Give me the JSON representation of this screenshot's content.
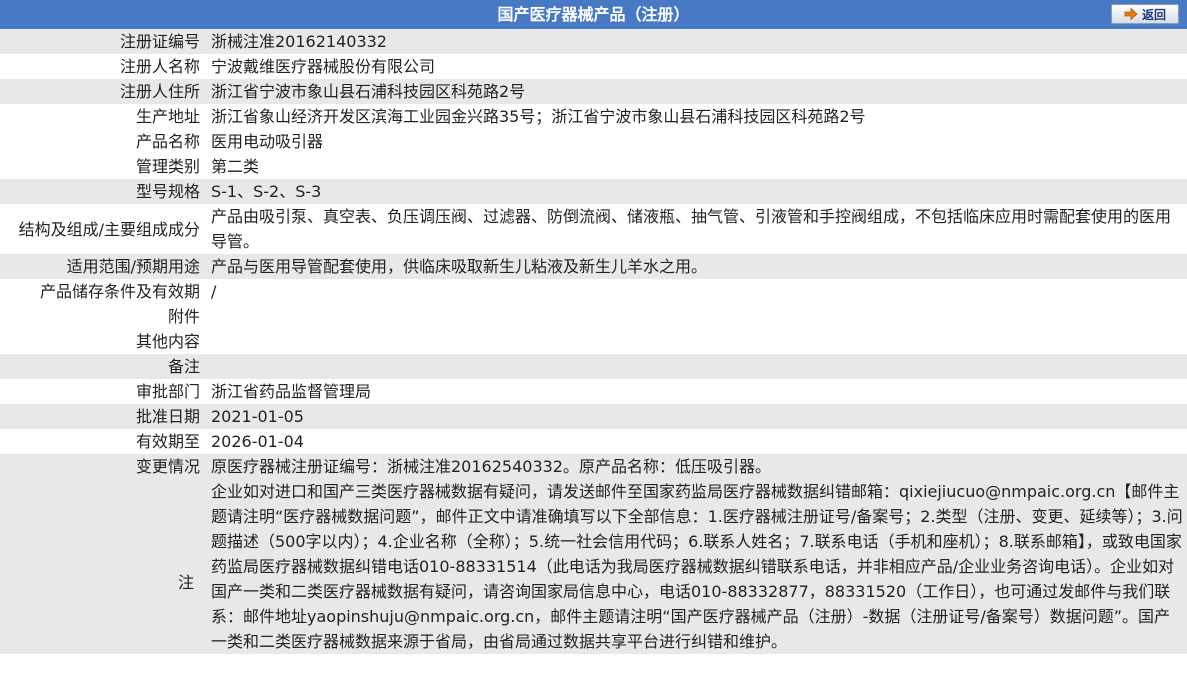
{
  "header": {
    "title": "国产医疗器械产品（注册）",
    "back_label": "返回"
  },
  "rows": {
    "reg_no": {
      "label": "注册证编号",
      "value": "浙械注准20162140332"
    },
    "registrant": {
      "label": "注册人名称",
      "value": "宁波戴维医疗器械股份有限公司"
    },
    "registrant_addr": {
      "label": "注册人住所",
      "value": "浙江省宁波市象山县石浦科技园区科苑路2号"
    },
    "production_addr": {
      "label": "生产地址",
      "value": "浙江省象山经济开发区滨海工业园金兴路35号；浙江省宁波市象山县石浦科技园区科苑路2号"
    },
    "product_name": {
      "label": "产品名称",
      "value": "医用电动吸引器"
    },
    "mgmt_class": {
      "label": "管理类别",
      "value": "第二类"
    },
    "model": {
      "label": "型号规格",
      "value": "S-1、S-2、S-3"
    },
    "structure": {
      "label": "结构及组成/主要组成成分",
      "value": "产品由吸引泵、真空表、负压调压阀、过滤器、防倒流阀、储液瓶、抽气管、引液管和手控阀组成，不包括临床应用时需配套使用的医用导管。"
    },
    "scope": {
      "label": "适用范围/预期用途",
      "value": "产品与医用导管配套使用，供临床吸取新生儿粘液及新生儿羊水之用。"
    },
    "storage": {
      "label": "产品储存条件及有效期",
      "value": "/"
    },
    "attachment": {
      "label": "附件",
      "value": ""
    },
    "other": {
      "label": "其他内容",
      "value": ""
    },
    "remark": {
      "label": "备注",
      "value": ""
    },
    "dept": {
      "label": "审批部门",
      "value": "浙江省药品监督管理局"
    },
    "approve_date": {
      "label": "批准日期",
      "value": "2021-01-05"
    },
    "valid_until": {
      "label": "有效期至",
      "value": "2026-01-04"
    },
    "change": {
      "label": "变更情况",
      "value": "原医疗器械注册证编号：浙械注准20162540332。原产品名称：低压吸引器。"
    },
    "note": {
      "label": "注",
      "value": "企业如对进口和国产三类医疗器械数据有疑问，请发送邮件至国家药监局医疗器械数据纠错邮箱：qixiejiucuo@nmpaic.org.cn【邮件主题请注明“医疗器械数据问题”，邮件正文中请准确填写以下全部信息：1.医疗器械注册证号/备案号；2.类型（注册、变更、延续等）；3.问题描述（500字以内）；4.企业名称（全称）；5.统一社会信用代码；6.联系人姓名；7.联系电话（手机和座机）；8.联系邮箱】，或致电国家药监局医疗器械数据纠错电话010-88331514（此电话为我局医疗器械数据纠错联系电话，并非相应产品/企业业务咨询电话）。企业如对国产一类和二类医疗器械数据有疑问，请咨询国家局信息中心，电话010-88332877，88331520（工作日），也可通过发邮件与我们联系：邮件地址yaopinshuju@nmpaic.org.cn，邮件主题请注明“国产医疗器械产品（注册）-数据（注册证号/备案号）数据问题”。国产一类和二类医疗器械数据来源于省局，由省局通过数据共享平台进行纠错和维护。"
    }
  },
  "colors": {
    "header_bg": "#4779c5",
    "row_shade": "#e8e8e8"
  },
  "icons": {
    "back": "arrow-right-icon"
  }
}
